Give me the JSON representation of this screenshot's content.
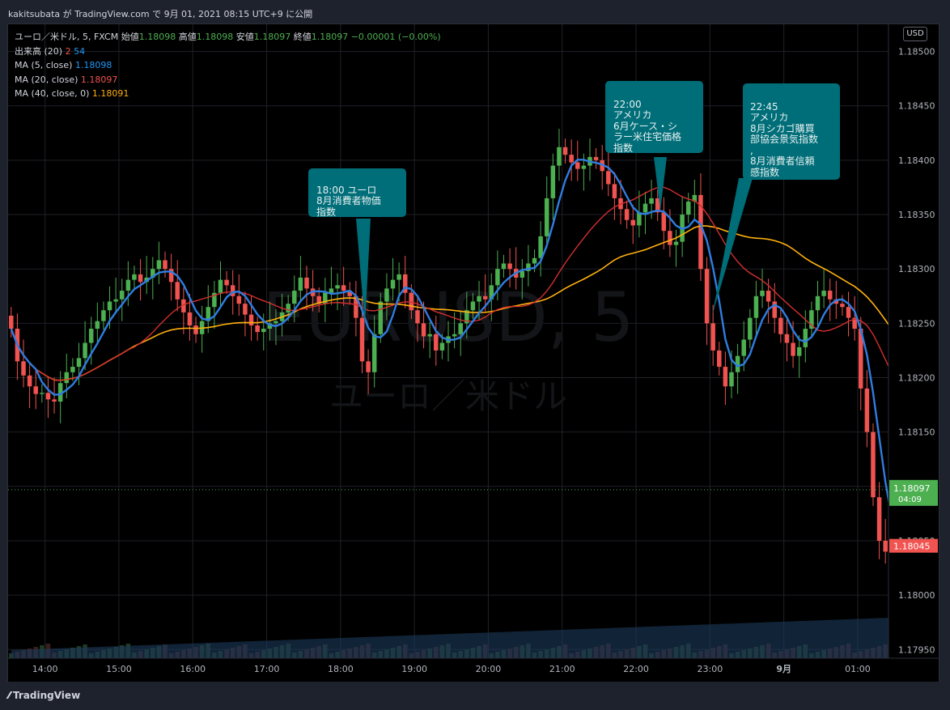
{
  "header": {
    "text": "kakitsubata が TradingView.com で 9月 01, 2021 08:15 UTC+9 に公開"
  },
  "legend": {
    "symbol": "ユーロ／米ドル, 5, FXCM",
    "open_label": "始値",
    "open": "1.18098",
    "high_label": "高値",
    "high": "1.18098",
    "low_label": "安値",
    "low": "1.18097",
    "close_label": "終値",
    "close": "1.18097",
    "change": "−0.00001 (−0.00%)",
    "volume_label": "出来高 (20)",
    "volume_v1": "2",
    "volume_v2": "54",
    "ma5_label": "MA (5, close)",
    "ma5_value": "1.18098",
    "ma20_label": "MA (20, close)",
    "ma20_value": "1.18097",
    "ma40_label": "MA (40, close, 0)",
    "ma40_value": "1.18091"
  },
  "currency_button": "USD",
  "watermark": {
    "symbol": "EURUSD, 5",
    "name": "ユーロ／米ドル"
  },
  "price_tag": {
    "price": "1.18097",
    "countdown": "04:09"
  },
  "price_tag2": "1.18045",
  "callouts": [
    {
      "text": "18:00 ユーロ\n8月消費者物価\n指数"
    },
    {
      "text": "22:00\nアメリカ\n6月ケース・シ\nラー米住宅価格\n指数"
    },
    {
      "text": "22:45\nアメリカ\n8月シカゴ購買\n部協会景気指数\n,\n8月消費者信頼\n感指数"
    }
  ],
  "footer": {
    "logo": "TradingView"
  },
  "colors": {
    "up": "#4caf50",
    "down": "#f05350",
    "ma5": "#2f7de1",
    "ma20": "#d32f2f",
    "ma40": "#ffb00d",
    "accent": "#006e79"
  },
  "chart_data": {
    "type": "candlestick",
    "symbol": "EURUSD",
    "interval": "5",
    "x_tick_labels": [
      "14:00",
      "15:00",
      "16:00",
      "17:00",
      "18:00",
      "19:00",
      "20:00",
      "21:00",
      "22:00",
      "23:00",
      "9月",
      "01:00"
    ],
    "y_tick_labels": [
      "1.18500",
      "1.18450",
      "1.18400",
      "1.18350",
      "1.18300",
      "1.18250",
      "1.18200",
      "1.18150",
      "1.18100",
      "1.18050",
      "1.18000",
      "1.17950"
    ],
    "ylim": [
      1.17942,
      1.18525
    ],
    "x_time_range": [
      "13:30",
      "01:25"
    ],
    "candle_interval_minutes": 5,
    "closes": [
      1.18245,
      1.18215,
      1.18202,
      1.18192,
      1.18185,
      1.18186,
      1.1818,
      1.18178,
      1.18195,
      1.18205,
      1.1821,
      1.18218,
      1.18232,
      1.18245,
      1.18252,
      1.18262,
      1.1827,
      1.18272,
      1.1828,
      1.1829,
      1.18295,
      1.18288,
      1.18292,
      1.183,
      1.18308,
      1.183,
      1.18288,
      1.18272,
      1.1826,
      1.18248,
      1.1824,
      1.18252,
      1.18265,
      1.18278,
      1.1829,
      1.18285,
      1.18275,
      1.18268,
      1.18258,
      1.18248,
      1.18242,
      1.18245,
      1.1825,
      1.18252,
      1.1826,
      1.18268,
      1.1828,
      1.18292,
      1.18282,
      1.18275,
      1.18268,
      1.18278,
      1.18282,
      1.18285,
      1.1828,
      1.18275,
      1.18255,
      1.18215,
      1.18205,
      1.1824,
      1.1827,
      1.18282,
      1.1829,
      1.18295,
      1.18278,
      1.18262,
      1.1825,
      1.18238,
      1.1824,
      1.18225,
      1.18232,
      1.18238,
      1.1824,
      1.1825,
      1.18262,
      1.1827,
      1.18275,
      1.18272,
      1.18285,
      1.183,
      1.18305,
      1.183,
      1.18292,
      1.18298,
      1.18305,
      1.1831,
      1.1833,
      1.18365,
      1.18395,
      1.18412,
      1.18405,
      1.18398,
      1.18392,
      1.18395,
      1.18403,
      1.184,
      1.1839,
      1.18378,
      1.18365,
      1.18355,
      1.18345,
      1.1834,
      1.18352,
      1.1836,
      1.18365,
      1.18352,
      1.18335,
      1.18322,
      1.18325,
      1.1835,
      1.18362,
      1.18368,
      1.183,
      1.1825,
      1.18225,
      1.1821,
      1.18192,
      1.18205,
      1.1822,
      1.18235,
      1.18255,
      1.18275,
      1.1828,
      1.1827,
      1.18255,
      1.1824,
      1.18232,
      1.1822,
      1.18228,
      1.18245,
      1.18262,
      1.18275,
      1.1828,
      1.18272,
      1.18268,
      1.18265,
      1.18255,
      1.18245,
      1.1819,
      1.1815,
      1.1809,
      1.1805,
      1.1804,
      1.1803,
      1.18042,
      1.18038,
      1.18032,
      1.18025,
      1.18015,
      1.18005,
      1.18,
      1.17998,
      1.17995,
      1.18005,
      1.1803,
      1.18045,
      1.18045
    ]
  }
}
